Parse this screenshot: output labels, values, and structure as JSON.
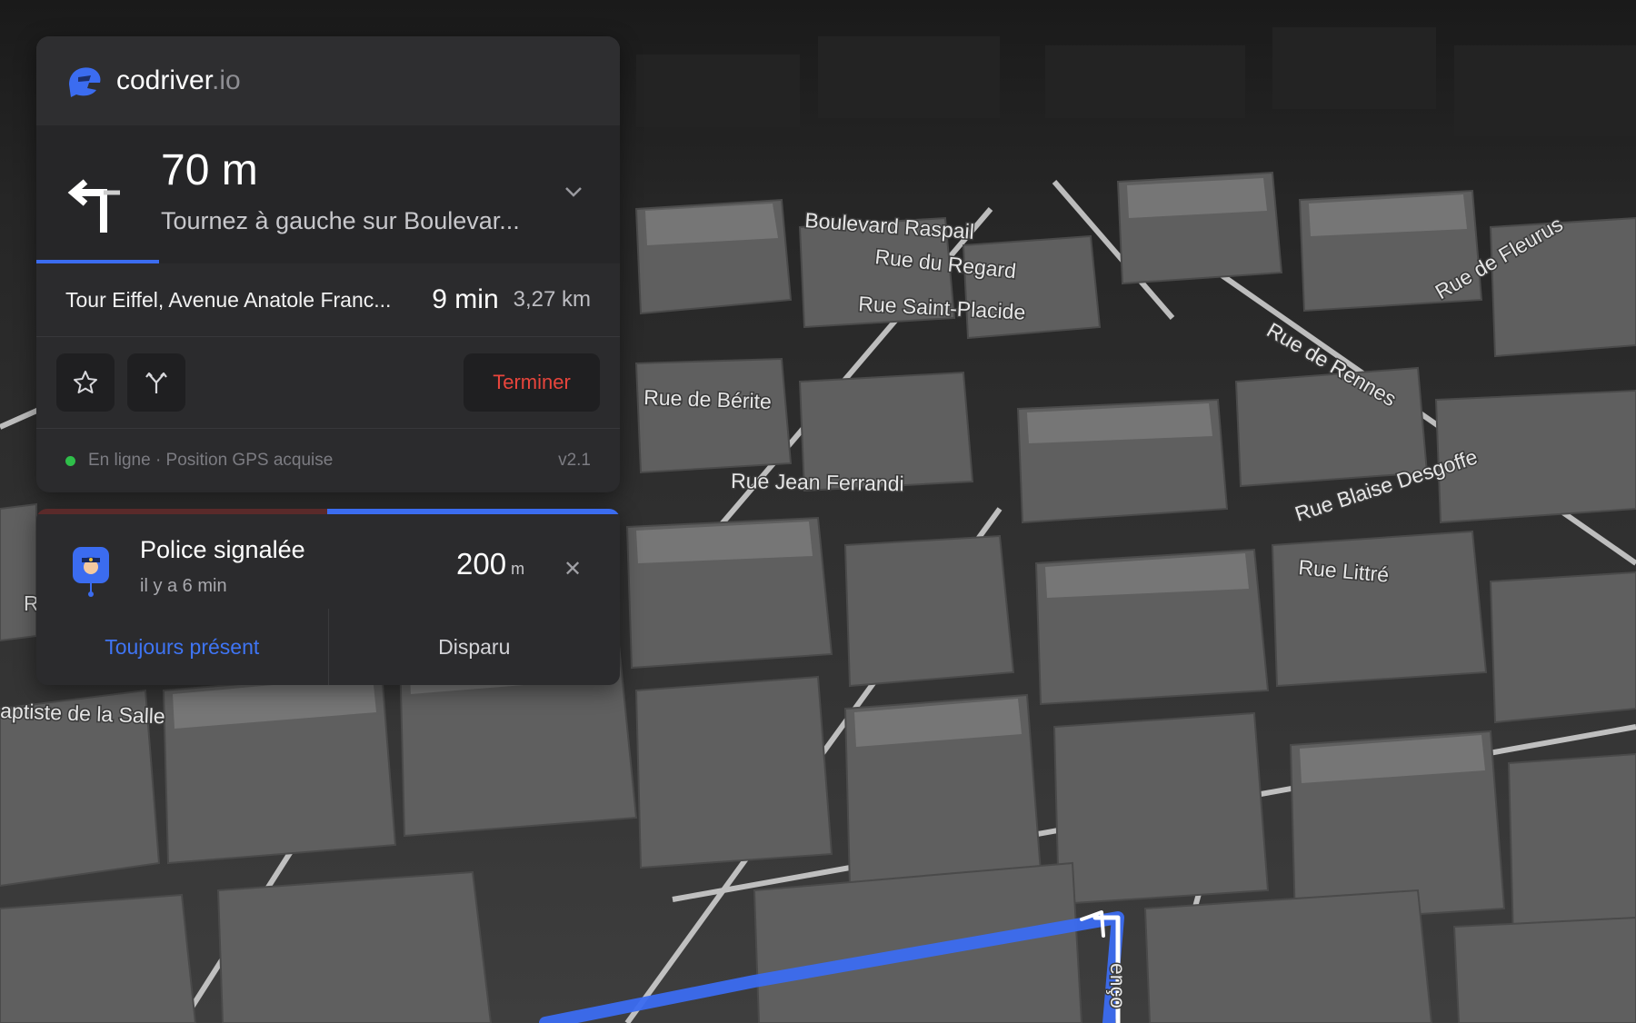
{
  "app": {
    "brand_main": "codriver",
    "brand_suffix": ".io",
    "logo_icon": "helmet-icon"
  },
  "navigation": {
    "distance": "70 m",
    "instruction": "Tournez à gauche sur Boulevar...",
    "maneuver_icon": "turn-left-icon",
    "step_progress": 0.21
  },
  "route": {
    "destination": "Tour Eiffel, Avenue Anatole Franc...",
    "eta": "9 min",
    "remaining_distance": "3,27 km"
  },
  "actions": {
    "favorite_icon": "star-icon",
    "alternate_route_icon": "fork-route-icon",
    "end_label": "Terminer"
  },
  "status": {
    "text": "En ligne · Position GPS acquise",
    "version": "v2.1",
    "indicator_color": "#2fbf4a"
  },
  "alert": {
    "title": "Police signalée",
    "time_ago": "il y a 6 min",
    "distance_value": "200",
    "distance_unit": "m",
    "close_icon": "close-icon",
    "confirm_label": "Toujours présent",
    "dismiss_label": "Disparu",
    "icon": "police-pin-icon"
  },
  "map": {
    "streets": [
      "Boulevard Raspail",
      "Rue du Regard",
      "Rue Saint-Placide",
      "Rue de Fleurus",
      "Rue de Rennes",
      "Rue de Bérite",
      "Rue Jean Ferrandi",
      "Rue Blaise Desgoffe",
      "Rue Littré",
      "aptiste de la Salle",
      "enço",
      "R"
    ]
  },
  "colors": {
    "accent": "#3b6cf0",
    "danger": "#e8453c",
    "panel": "#2b2b2d"
  }
}
